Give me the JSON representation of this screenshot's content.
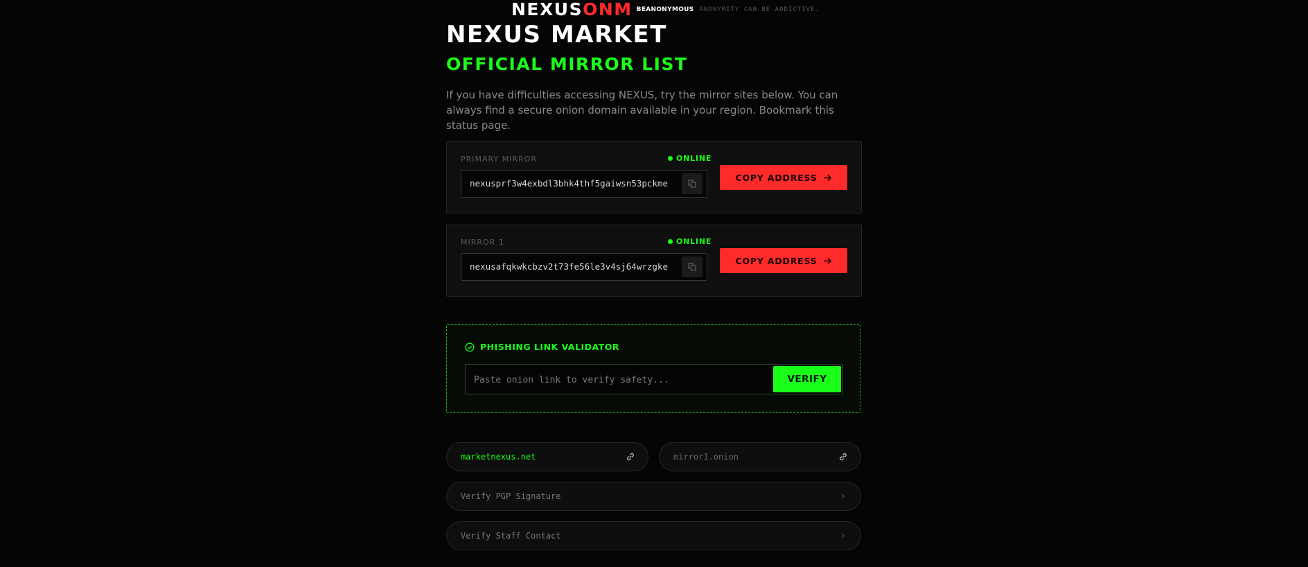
{
  "header": {
    "logo_main": "NEXUS",
    "logo_accent": "ONM",
    "brand": "BEANONYMOUS",
    "tagline": "ANONYMITY CAN BE ADDICTIVE."
  },
  "page": {
    "title": "NEXUS MARKET",
    "subtitle": "OFFICIAL MIRROR LIST",
    "intro": "If you have difficulties accessing NEXUS, try the mirror sites below. You can always find a secure onion domain available in your region. Bookmark this status page."
  },
  "mirrors": [
    {
      "label": "PRIMARY MIRROR",
      "status": "ONLINE",
      "address": "nexusprf3w4exbdl3bhk4thf5gaiwsn53pckme",
      "copy_label": "COPY ADDRESS"
    },
    {
      "label": "MIRROR 1",
      "status": "ONLINE",
      "address": "nexusafqkwkcbzv2t73fe56le3v4sj64wrzgke",
      "copy_label": "COPY ADDRESS"
    }
  ],
  "validator": {
    "title": "PHISHING LINK VALIDATOR",
    "placeholder": "Paste onion link to verify safety...",
    "button": "VERIFY"
  },
  "links": {
    "clearnet": "marketnexus.net",
    "onion": "mirror1.onion",
    "pgp": "Verify PGP Signature",
    "staff": "Verify Staff Contact"
  },
  "colors": {
    "accent_green": "#19ff19",
    "accent_red": "#ff2a2a",
    "background": "#050505"
  }
}
